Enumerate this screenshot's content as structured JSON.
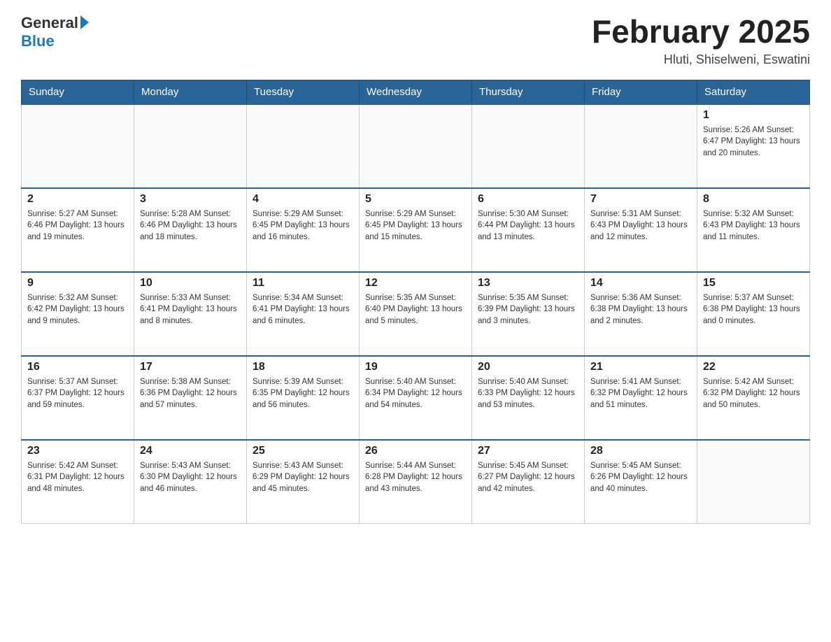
{
  "header": {
    "logo_general": "General",
    "logo_blue": "Blue",
    "month_title": "February 2025",
    "location": "Hluti, Shiselweni, Eswatini"
  },
  "weekdays": [
    "Sunday",
    "Monday",
    "Tuesday",
    "Wednesday",
    "Thursday",
    "Friday",
    "Saturday"
  ],
  "weeks": [
    [
      {
        "day": "",
        "info": ""
      },
      {
        "day": "",
        "info": ""
      },
      {
        "day": "",
        "info": ""
      },
      {
        "day": "",
        "info": ""
      },
      {
        "day": "",
        "info": ""
      },
      {
        "day": "",
        "info": ""
      },
      {
        "day": "1",
        "info": "Sunrise: 5:26 AM\nSunset: 6:47 PM\nDaylight: 13 hours\nand 20 minutes."
      }
    ],
    [
      {
        "day": "2",
        "info": "Sunrise: 5:27 AM\nSunset: 6:46 PM\nDaylight: 13 hours\nand 19 minutes."
      },
      {
        "day": "3",
        "info": "Sunrise: 5:28 AM\nSunset: 6:46 PM\nDaylight: 13 hours\nand 18 minutes."
      },
      {
        "day": "4",
        "info": "Sunrise: 5:29 AM\nSunset: 6:45 PM\nDaylight: 13 hours\nand 16 minutes."
      },
      {
        "day": "5",
        "info": "Sunrise: 5:29 AM\nSunset: 6:45 PM\nDaylight: 13 hours\nand 15 minutes."
      },
      {
        "day": "6",
        "info": "Sunrise: 5:30 AM\nSunset: 6:44 PM\nDaylight: 13 hours\nand 13 minutes."
      },
      {
        "day": "7",
        "info": "Sunrise: 5:31 AM\nSunset: 6:43 PM\nDaylight: 13 hours\nand 12 minutes."
      },
      {
        "day": "8",
        "info": "Sunrise: 5:32 AM\nSunset: 6:43 PM\nDaylight: 13 hours\nand 11 minutes."
      }
    ],
    [
      {
        "day": "9",
        "info": "Sunrise: 5:32 AM\nSunset: 6:42 PM\nDaylight: 13 hours\nand 9 minutes."
      },
      {
        "day": "10",
        "info": "Sunrise: 5:33 AM\nSunset: 6:41 PM\nDaylight: 13 hours\nand 8 minutes."
      },
      {
        "day": "11",
        "info": "Sunrise: 5:34 AM\nSunset: 6:41 PM\nDaylight: 13 hours\nand 6 minutes."
      },
      {
        "day": "12",
        "info": "Sunrise: 5:35 AM\nSunset: 6:40 PM\nDaylight: 13 hours\nand 5 minutes."
      },
      {
        "day": "13",
        "info": "Sunrise: 5:35 AM\nSunset: 6:39 PM\nDaylight: 13 hours\nand 3 minutes."
      },
      {
        "day": "14",
        "info": "Sunrise: 5:36 AM\nSunset: 6:38 PM\nDaylight: 13 hours\nand 2 minutes."
      },
      {
        "day": "15",
        "info": "Sunrise: 5:37 AM\nSunset: 6:38 PM\nDaylight: 13 hours\nand 0 minutes."
      }
    ],
    [
      {
        "day": "16",
        "info": "Sunrise: 5:37 AM\nSunset: 6:37 PM\nDaylight: 12 hours\nand 59 minutes."
      },
      {
        "day": "17",
        "info": "Sunrise: 5:38 AM\nSunset: 6:36 PM\nDaylight: 12 hours\nand 57 minutes."
      },
      {
        "day": "18",
        "info": "Sunrise: 5:39 AM\nSunset: 6:35 PM\nDaylight: 12 hours\nand 56 minutes."
      },
      {
        "day": "19",
        "info": "Sunrise: 5:40 AM\nSunset: 6:34 PM\nDaylight: 12 hours\nand 54 minutes."
      },
      {
        "day": "20",
        "info": "Sunrise: 5:40 AM\nSunset: 6:33 PM\nDaylight: 12 hours\nand 53 minutes."
      },
      {
        "day": "21",
        "info": "Sunrise: 5:41 AM\nSunset: 6:32 PM\nDaylight: 12 hours\nand 51 minutes."
      },
      {
        "day": "22",
        "info": "Sunrise: 5:42 AM\nSunset: 6:32 PM\nDaylight: 12 hours\nand 50 minutes."
      }
    ],
    [
      {
        "day": "23",
        "info": "Sunrise: 5:42 AM\nSunset: 6:31 PM\nDaylight: 12 hours\nand 48 minutes."
      },
      {
        "day": "24",
        "info": "Sunrise: 5:43 AM\nSunset: 6:30 PM\nDaylight: 12 hours\nand 46 minutes."
      },
      {
        "day": "25",
        "info": "Sunrise: 5:43 AM\nSunset: 6:29 PM\nDaylight: 12 hours\nand 45 minutes."
      },
      {
        "day": "26",
        "info": "Sunrise: 5:44 AM\nSunset: 6:28 PM\nDaylight: 12 hours\nand 43 minutes."
      },
      {
        "day": "27",
        "info": "Sunrise: 5:45 AM\nSunset: 6:27 PM\nDaylight: 12 hours\nand 42 minutes."
      },
      {
        "day": "28",
        "info": "Sunrise: 5:45 AM\nSunset: 6:26 PM\nDaylight: 12 hours\nand 40 minutes."
      },
      {
        "day": "",
        "info": ""
      }
    ]
  ]
}
